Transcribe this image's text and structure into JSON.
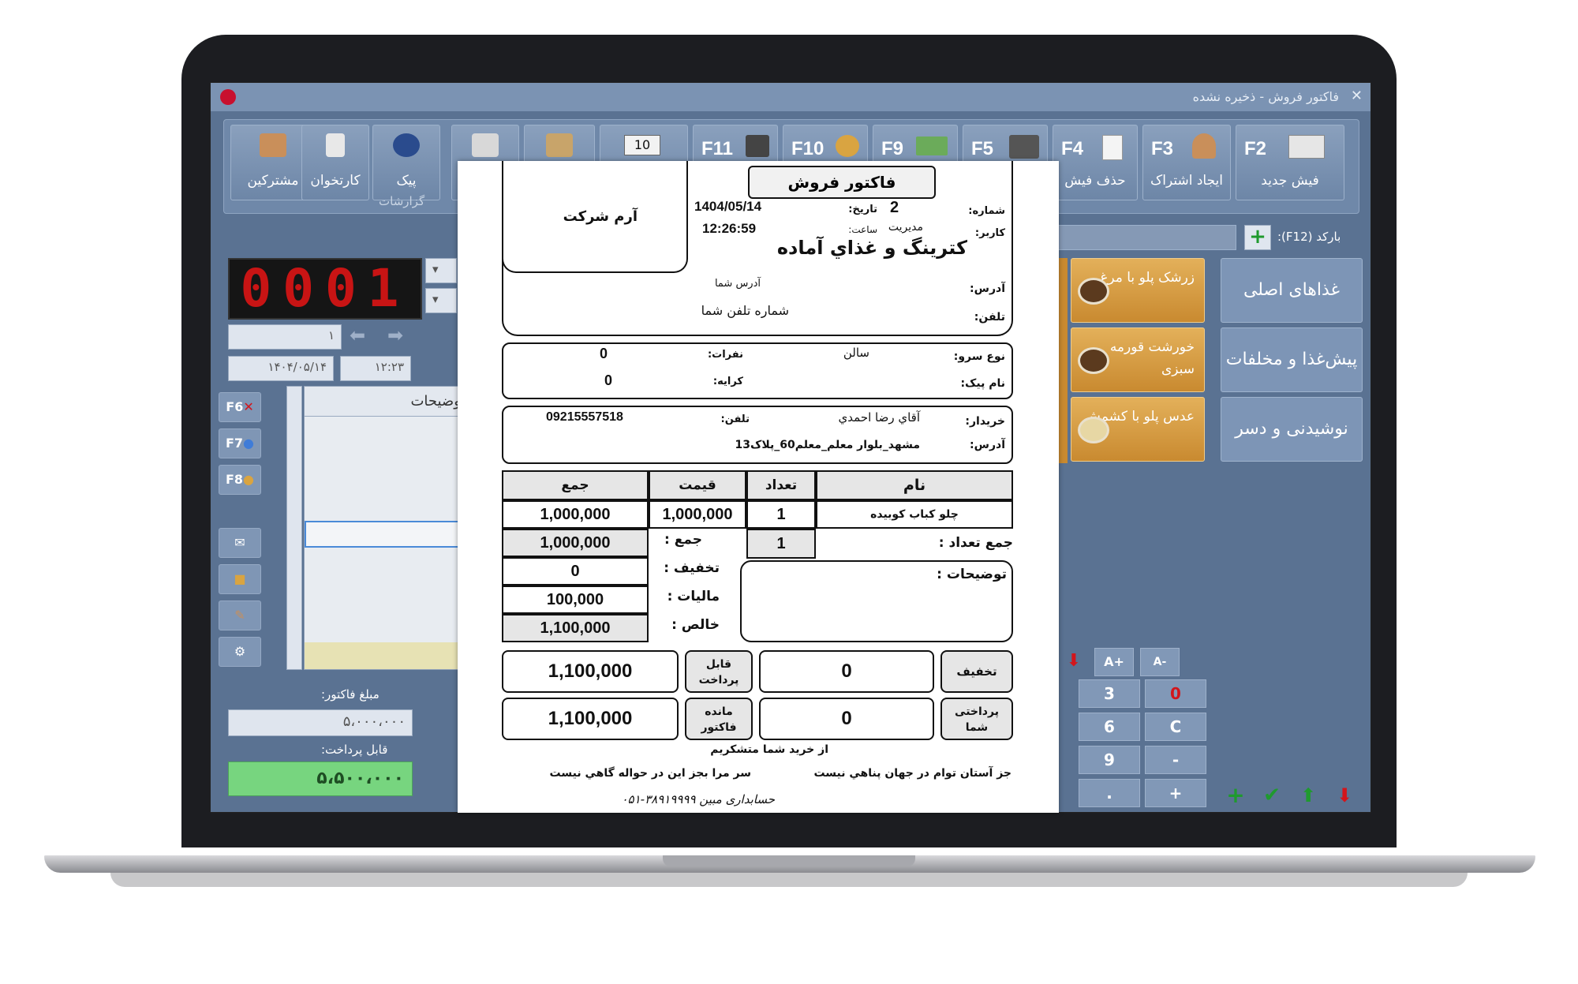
{
  "window": {
    "title": "فاکتور فروش - ذخیره نشده",
    "close": "✕"
  },
  "toolbar": {
    "customers": "مشترکین",
    "card_reader": "کارتخوان",
    "courier": "پیک",
    "reports": "گزارشات",
    "copies": "10",
    "f11": "F11",
    "f10": "F10",
    "f9": "F9",
    "f5": "F5",
    "f4": "F4",
    "f4_label": "حذف فیش",
    "f3": "F3",
    "f3_label": "ایجاد اشتراک",
    "f2": "F2",
    "f2_label": "فیش جدید"
  },
  "barcode": {
    "label": "بارکد (F12):"
  },
  "led_number": "0001",
  "left_fields": {
    "counter": "۱",
    "date": "۱۴۰۴/۰۵/۱۴",
    "time": "۱۲:۲۳"
  },
  "side_keys": [
    {
      "key": "F6"
    },
    {
      "key": "F7"
    },
    {
      "key": "F8"
    }
  ],
  "grid": {
    "header": "توضیحات"
  },
  "totals": {
    "invoice_label": "مبلغ فاکتور:",
    "invoice_value": "۵،۰۰۰،۰۰۰",
    "payable_label": "قابل پرداخت:",
    "payable_value": "۵،۵۰۰،۰۰۰"
  },
  "categories": [
    {
      "label": "غذاهای اصلی"
    },
    {
      "label": "پیش‌غذا و مخلفات"
    },
    {
      "label": "نوشیدنی و دسر"
    }
  ],
  "foods": [
    {
      "label": "زرشک پلو با مرغ"
    },
    {
      "label": "خورشت قورمه سبزی"
    },
    {
      "label": "عدس پلو با کشمش"
    }
  ],
  "font_buttons": {
    "bigger": "A+",
    "smaller": "A-"
  },
  "keypad": [
    "3",
    "0",
    "6",
    "C",
    "9",
    "-",
    ".",
    "+"
  ],
  "receipt": {
    "title": "فاکتور فروش",
    "company": "آرم شرکت",
    "number_label": "شماره:",
    "number": "2",
    "date_label": "تاریخ:",
    "date": "1404/05/14",
    "user_label": "کاربر:",
    "user": "مدیریت",
    "time_label": "ساعت:",
    "time": "12:26:59",
    "business": "کترینگ و غذاي آماده",
    "address_label": "آدرس:",
    "address": "آدرس شما",
    "phone_label": "تلفن:",
    "phone": "شماره تلفن شما",
    "service_label": "نوع سرو:",
    "service": "سالن",
    "seats_label": "نفرات:",
    "seats": "0",
    "courier_label": "نام پیک:",
    "fee_label": "کرایه:",
    "fee": "0",
    "buyer_label": "خریدار:",
    "buyer": "آقاي رضا احمدي",
    "buyer_phone_label": "تلفن:",
    "buyer_phone": "09215557518",
    "buyer_address_label": "آدرس:",
    "buyer_address": "مشهد_بلوار معلم_معلم60_پلاک13",
    "col_name": "نام",
    "col_qty": "تعداد",
    "col_price": "قیمت",
    "col_total": "جمع",
    "item_name": "چلو کباب کوبیده",
    "item_qty": "1",
    "item_price": "1,000,000",
    "item_total": "1,000,000",
    "sum_label": "جمع :",
    "sum_value": "1,000,000",
    "qty_sum_label": "جمع تعداد :",
    "qty_sum": "1",
    "discount_label": "تخفیف :",
    "discount_value": "0",
    "tax_label": "مالیات :",
    "tax_value": "100,000",
    "net_label": "خالص :",
    "net_value": "1,100,000",
    "notes_label": "توضیحات :",
    "payable_label": "قابل پرداخت",
    "payable_value": "1,100,000",
    "discount_box_label": "تخفیف",
    "discount_box_value": "0",
    "remaining_label": "مانده فاکتور",
    "remaining_value": "1,100,000",
    "paid_label": "پرداختی شما",
    "paid_value": "0",
    "thanks": "از خرید شما متشکریم",
    "poem_right": "جز آستان توام در جهان پناهي نيست",
    "poem_left": "سر مرا بجز اين در حواله گاهي نيست",
    "footer": "حسابداری مبین ۳۸۹۱۹۹۹۹-۰۵۱"
  }
}
